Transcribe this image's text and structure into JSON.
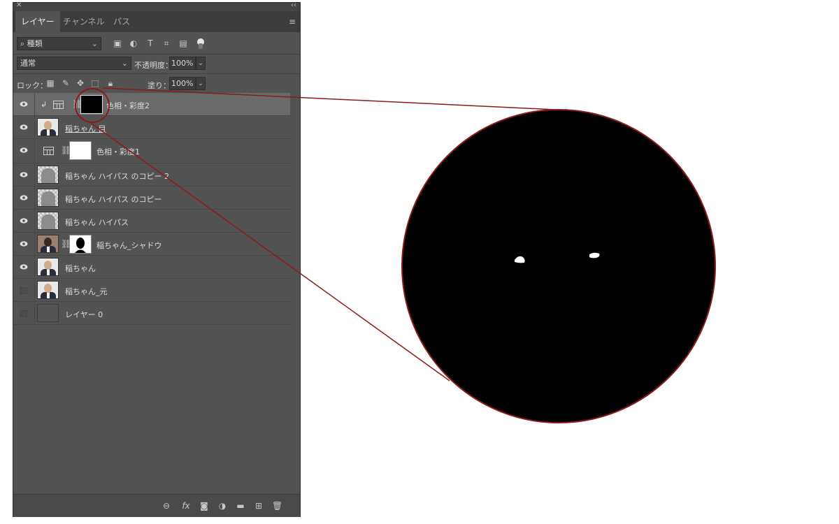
{
  "panel": {
    "close_glyph": "✕",
    "collapse_glyph": "‹‹",
    "menu_glyph": "≡",
    "tabs": [
      {
        "label": "レイヤー",
        "active": true
      },
      {
        "label": "チャンネル",
        "active": false
      },
      {
        "label": "パス",
        "active": false
      }
    ],
    "filter": {
      "value": "種類",
      "icons": [
        "image-filter-icon",
        "adjustment-filter-icon",
        "type-filter-icon",
        "shape-filter-icon",
        "smart-object-filter-icon"
      ]
    },
    "blend": {
      "mode": "通常",
      "opacity_label": "不透明度：",
      "opacity": "100%"
    },
    "lock": {
      "label": "ロック：",
      "fill_label": "塗り：",
      "fill": "100%"
    },
    "layers": [
      {
        "name": "色相・彩度2",
        "visible": true,
        "selected": true,
        "type": "adjustment-clipped"
      },
      {
        "name": "稲ちゃん 目",
        "visible": true,
        "selected": false,
        "type": "photo"
      },
      {
        "name": "色相・彩度1",
        "visible": true,
        "selected": false,
        "type": "adjustment"
      },
      {
        "name": "稲ちゃん ハイパス のコピー 2",
        "visible": true,
        "selected": false,
        "type": "gray"
      },
      {
        "name": "稲ちゃん ハイパス のコピー",
        "visible": true,
        "selected": false,
        "type": "gray"
      },
      {
        "name": "稲ちゃん ハイパス",
        "visible": true,
        "selected": false,
        "type": "gray"
      },
      {
        "name": "稲ちゃん_シャドウ",
        "visible": true,
        "selected": false,
        "type": "photo-masked"
      },
      {
        "name": "稲ちゃん",
        "visible": true,
        "selected": false,
        "type": "photo"
      },
      {
        "name": "稲ちゃん_元",
        "visible": false,
        "selected": false,
        "type": "photo"
      },
      {
        "name": "レイヤー 0",
        "visible": false,
        "selected": false,
        "type": "empty"
      }
    ],
    "bottom_icons": [
      "link-layers-icon",
      "fx-icon",
      "add-mask-icon",
      "new-adjustment-icon",
      "new-group-icon",
      "new-layer-icon",
      "trash-icon"
    ],
    "fx_label": "fx"
  },
  "zoom": {
    "outline_color": "#8b1a1a",
    "fill_color": "#000000",
    "highlight_color": "#ffffff"
  }
}
